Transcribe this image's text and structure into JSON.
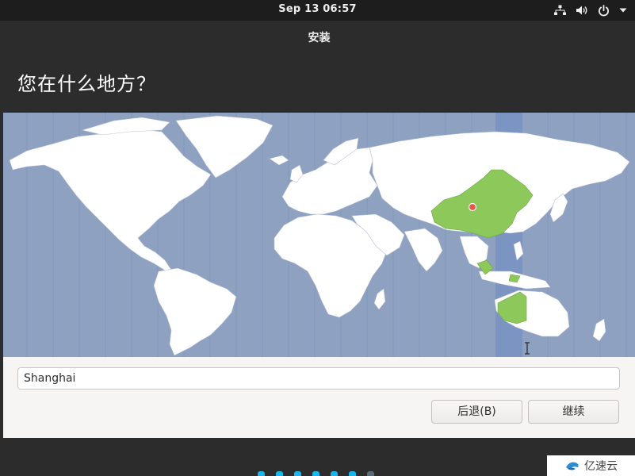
{
  "topbar": {
    "clock": "Sep 13  06:57",
    "icons": [
      "network-icon",
      "volume-icon",
      "power-icon",
      "chevron-down-icon"
    ]
  },
  "window": {
    "title": "安装",
    "question": "您在什么地方？"
  },
  "map": {
    "selected_region_color": "#8cc85a",
    "timezone_band_color": "#7b94c2",
    "ocean_color": "#8ea1c1",
    "land_color": "#ffffff",
    "pin_color": "#e8584a"
  },
  "location": {
    "value": "Shanghai"
  },
  "buttons": {
    "back": "后退(B)",
    "continue": "继续"
  },
  "progress": {
    "total_steps": 7,
    "completed_steps": 6
  },
  "watermark": {
    "text": "亿速云"
  }
}
